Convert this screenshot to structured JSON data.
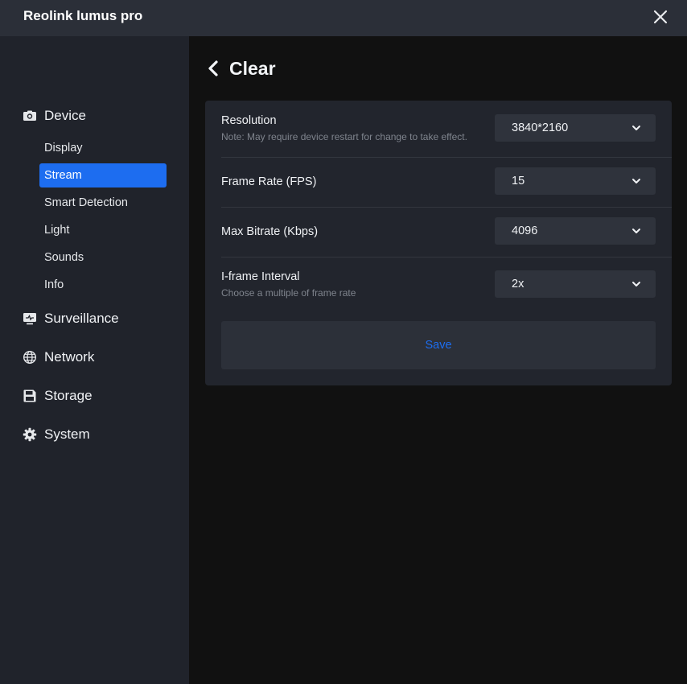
{
  "app": {
    "title": "Reolink lumus pro"
  },
  "sidebar": {
    "sections": [
      {
        "label": "Device",
        "icon": "camera-icon"
      },
      {
        "label": "Surveillance",
        "icon": "monitor-icon"
      },
      {
        "label": "Network",
        "icon": "globe-icon"
      },
      {
        "label": "Storage",
        "icon": "floppy-disk-icon"
      },
      {
        "label": "System",
        "icon": "gear-icon"
      }
    ],
    "device_items": [
      {
        "label": "Display",
        "active": false
      },
      {
        "label": "Stream",
        "active": true
      },
      {
        "label": "Smart Detection",
        "active": false
      },
      {
        "label": "Light",
        "active": false
      },
      {
        "label": "Sounds",
        "active": false
      },
      {
        "label": "Info",
        "active": false
      }
    ]
  },
  "page": {
    "title": "Clear",
    "settings": [
      {
        "label": "Resolution",
        "note": "Note: May require device restart for change to take effect.",
        "value": "3840*2160"
      },
      {
        "label": "Frame Rate (FPS)",
        "note": "",
        "value": "15"
      },
      {
        "label": "Max Bitrate (Kbps)",
        "note": "",
        "value": "4096"
      },
      {
        "label": "I-frame Interval",
        "note": "Choose a multiple of frame rate",
        "value": "2x"
      }
    ],
    "save_label": "Save"
  },
  "colors": {
    "accent": "#1d6df0",
    "titlebar_bg": "#2b2f38",
    "sidebar_bg": "#20232b",
    "content_bg": "#111111",
    "card_bg": "#22252d",
    "select_bg": "#2f333c"
  }
}
